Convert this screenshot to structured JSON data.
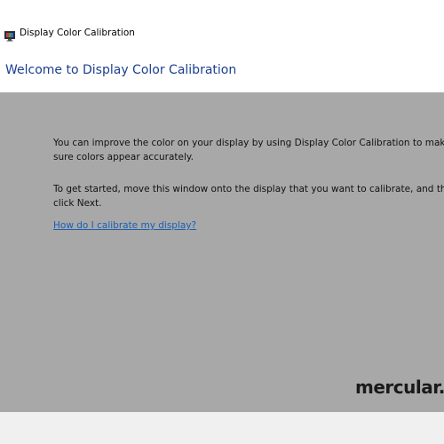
{
  "window": {
    "title": "Display Color Calibration",
    "app_icon": "monitor-icon"
  },
  "page": {
    "heading": "Welcome to Display Color Calibration",
    "paragraph1": "You can improve the color on your display by using Display Color Calibration to make sure colors appear accurately.",
    "paragraph2": "To get started, move this window onto the display that you want to calibrate, and then click Next.",
    "help_link": "How do I calibrate my display?"
  },
  "watermark": {
    "logo_text": "mercular."
  },
  "colors": {
    "heading": "#1c3f8f",
    "link": "#1a5fb4",
    "content_bg": "#a8a8a8",
    "footer_bg": "#f0f0f0"
  }
}
